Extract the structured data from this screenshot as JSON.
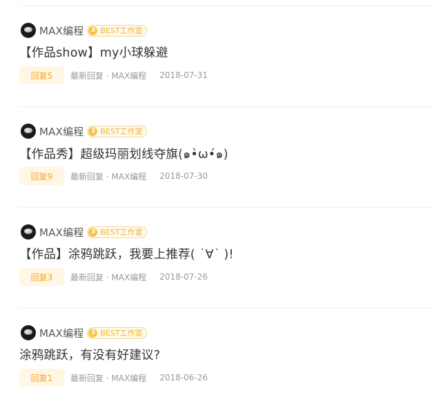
{
  "posts": [
    {
      "author": "MAX编程",
      "badge_number": "3",
      "badge_text": "BEST工作室",
      "title": "【作品show】my小球躲避",
      "reply_label": "回复5",
      "last_reply": "最新回复 · MAX编程",
      "date": "2018-07-31"
    },
    {
      "author": "MAX编程",
      "badge_number": "3",
      "badge_text": "BEST工作室",
      "title": "【作品秀】超级玛丽划线夺旗(๑•̀ω•́๑)",
      "reply_label": "回复9",
      "last_reply": "最新回复 · MAX编程",
      "date": "2018-07-30"
    },
    {
      "author": "MAX编程",
      "badge_number": "3",
      "badge_text": "BEST工作室",
      "title": "【作品】涂鸦跳跃，我要上推荐( ˙∀˙ )!",
      "reply_label": "回复3",
      "last_reply": "最新回复 · MAX编程",
      "date": "2018-07-26"
    },
    {
      "author": "MAX编程",
      "badge_number": "3",
      "badge_text": "BEST工作室",
      "title": "涂鸦跳跃，有没有好建议?",
      "reply_label": "回复1",
      "last_reply": "最新回复 · MAX编程",
      "date": "2018-06-26"
    }
  ],
  "icons": {
    "avatar": "avatar-icon",
    "badge": "level-badge-icon"
  },
  "colors": {
    "accent": "#f5a623",
    "badge_gold": "#f7c24a",
    "reply_chip_bg": "#fff6e4",
    "meta_text": "#999999",
    "title_text": "#333333"
  }
}
